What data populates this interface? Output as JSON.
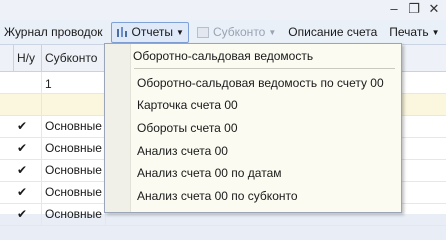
{
  "window": {
    "minimize": "–",
    "restore": "❐",
    "close": "✕"
  },
  "toolbar": {
    "journal": "Журнал проводок",
    "reports": "Отчеты",
    "subkonto": "Субконто",
    "account_desc": "Описание счета",
    "print": "Печать",
    "help": "?"
  },
  "grid": {
    "columns": [
      "",
      "Н/у",
      "Субконто 1"
    ],
    "rows": [
      {
        "check": "",
        "text": ""
      },
      {
        "check": "",
        "text": ""
      },
      {
        "check": "✔",
        "text": "Основные"
      },
      {
        "check": "✔",
        "text": "Основные"
      },
      {
        "check": "✔",
        "text": "Основные"
      },
      {
        "check": "✔",
        "text": "Основные"
      },
      {
        "check": "✔",
        "text": "Основные"
      }
    ]
  },
  "reports_menu": {
    "items": [
      "Оборотно-сальдовая ведомость",
      "Оборотно-сальдовая ведомость по счету 00",
      "Карточка счета 00",
      "Обороты счета 00",
      "Анализ счета 00",
      "Анализ счета 00 по датам",
      "Анализ счета 00 по субконто"
    ]
  }
}
